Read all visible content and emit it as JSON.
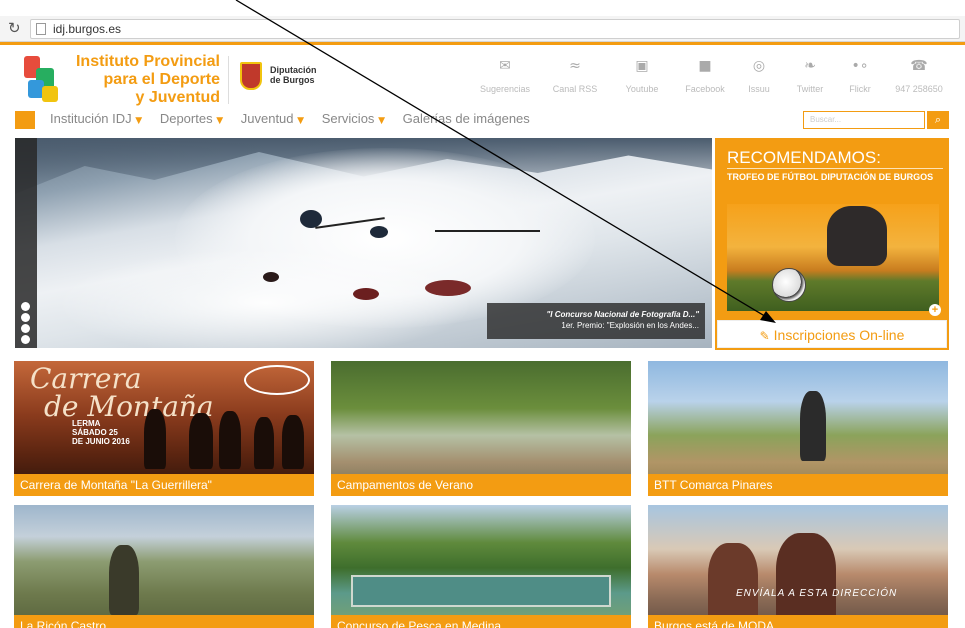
{
  "browser": {
    "reload_icon": "reload-icon",
    "url": "idj.burgos.es"
  },
  "header": {
    "logo_line1": "Instituto Provincial",
    "logo_line2": "para el Deporte",
    "logo_line3": "y Juventud",
    "diputacion_line1": "Diputación",
    "diputacion_line2": "de Burgos"
  },
  "social": [
    {
      "label": "Sugerencias",
      "icon": "mail-icon"
    },
    {
      "label": "Canal RSS",
      "icon": "rss-icon"
    },
    {
      "label": "Youtube",
      "icon": "youtube-icon"
    },
    {
      "label": "Facebook",
      "icon": "facebook-icon"
    },
    {
      "label": "Issuu",
      "icon": "issuu-icon"
    },
    {
      "label": "Twitter",
      "icon": "twitter-icon"
    },
    {
      "label": "Flickr",
      "icon": "flickr-icon"
    },
    {
      "label": "947 258650",
      "icon": "phone-icon"
    }
  ],
  "nav": {
    "items": [
      {
        "label": "Institución IDJ",
        "dropdown": true
      },
      {
        "label": "Deportes",
        "dropdown": true
      },
      {
        "label": "Juventud",
        "dropdown": true
      },
      {
        "label": "Servicios",
        "dropdown": true
      },
      {
        "label": "Galerías de imágenes",
        "dropdown": false
      }
    ],
    "search_placeholder": "Buscar..."
  },
  "hero": {
    "caption_title": "\"I Concurso Nacional de Fotografía D...\"",
    "caption_sub": "1er. Premio: \"Explosión en los Andes..."
  },
  "recomendamos": {
    "title": "RECOMENDAMOS:",
    "subtitle": "TROFEO DE FÚTBOL DIPUTACIÓN DE BURGOS",
    "button": "Inscripciones On-line"
  },
  "tiles": [
    {
      "label": "Carrera de Montaña \"La Guerrillera\""
    },
    {
      "label": "Campamentos de Verano"
    },
    {
      "label": "BTT Comarca Pinares"
    },
    {
      "label": "La Ricón Castro"
    },
    {
      "label": "Concurso de Pesca en Medina"
    },
    {
      "label": "Burgos está de MODA"
    }
  ],
  "tile_art": {
    "carrera_line1": "Carrera",
    "carrera_line2": "de Montaña",
    "lerma_l1": "LERMA",
    "lerma_l2": "SÁBADO 25",
    "lerma_l3": "DE JUNIO 2016",
    "moda_text": "ENVÍALA A ESTA DIRECCIÓN"
  },
  "colors": {
    "accent": "#f39c12",
    "nav_text": "#888888"
  }
}
